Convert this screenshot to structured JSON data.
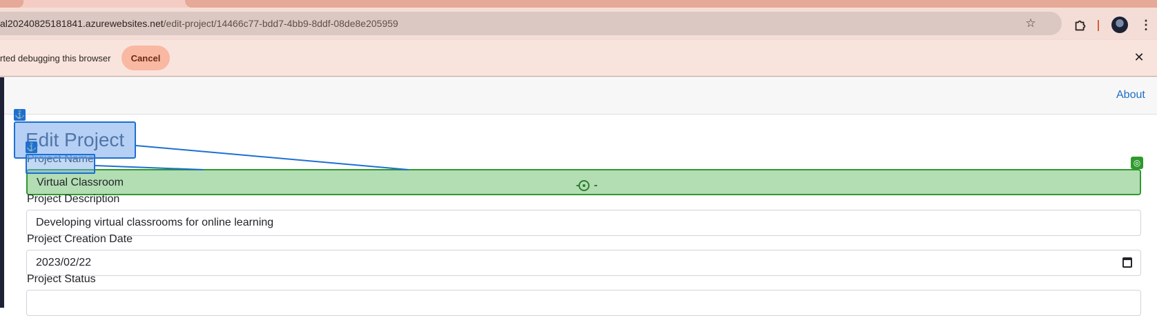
{
  "browser": {
    "url_host": "al20240825181841.azurewebsites.net",
    "url_path": "/edit-project/14466c77-bdd7-4bb9-8ddf-08de8e205959",
    "icons": {
      "bookmark": "star-icon",
      "extensions": "puzzle-icon",
      "profile": "avatar",
      "menu": "kebab-menu-icon"
    }
  },
  "infobar": {
    "message": "rted debugging this browser",
    "cancel_label": "Cancel",
    "close_glyph": "✕"
  },
  "navbar": {
    "about_label": "About"
  },
  "form": {
    "title": "Edit Project",
    "project_name_label": "Project Name",
    "project_name_value": "Virtual Classroom",
    "description_label": "Project Description",
    "description_value": "Developing virtual classrooms for online learning",
    "creation_date_label": "Project Creation Date",
    "creation_date_value": "2023/02/22",
    "status_label": "Project Status"
  },
  "overlay": {
    "anchor_glyph": "⚓",
    "target_glyph": "◎"
  },
  "colors": {
    "chrome_accent": "#f4ddd7",
    "link": "#1b6ec2",
    "overlay_blue": "#1d6fd1",
    "overlay_green": "#2e9a2e",
    "highlight_fill": "#b3ddb3"
  }
}
